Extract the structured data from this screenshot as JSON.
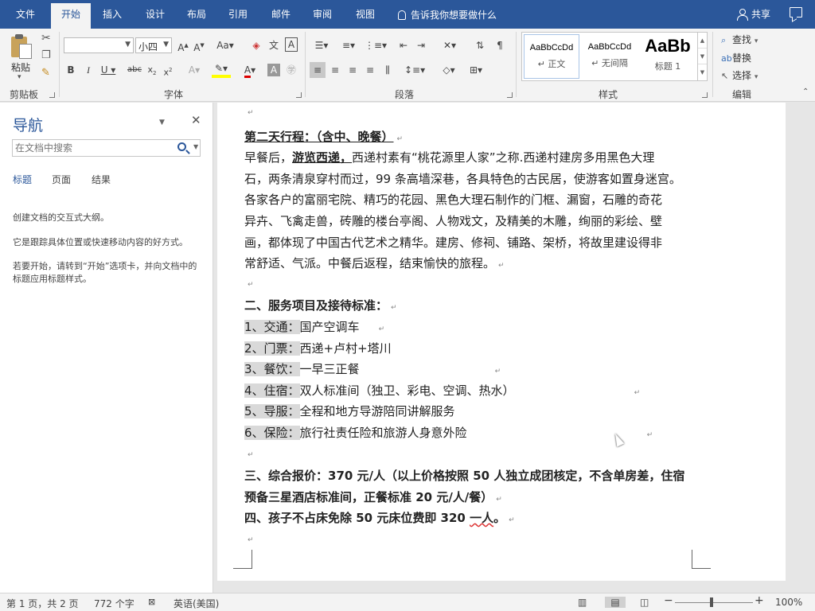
{
  "tabs": {
    "file": "文件",
    "home": "开始",
    "insert": "插入",
    "design": "设计",
    "layout": "布局",
    "references": "引用",
    "mailings": "邮件",
    "review": "审阅",
    "view": "视图",
    "tell_me": "告诉我你想要做什么",
    "share": "共享"
  },
  "ribbon": {
    "clipboard": {
      "paste": "粘贴",
      "label": "剪贴板"
    },
    "font": {
      "name": "",
      "size": "小四",
      "label": "字体"
    },
    "paragraph": {
      "label": "段落"
    },
    "styles": {
      "label": "样式",
      "items": [
        {
          "sample": "AaBbCcDd",
          "name": "↵ 正文"
        },
        {
          "sample": "AaBbCcDd",
          "name": "↵ 无间隔"
        },
        {
          "sample": "AaBb",
          "name": "标题 1"
        }
      ]
    },
    "editing": {
      "find": "查找",
      "replace": "替换",
      "select": "选择",
      "label": "编辑"
    }
  },
  "nav": {
    "title": "导航",
    "search_placeholder": "在文档中搜索",
    "tabs": [
      "标题",
      "页面",
      "结果"
    ],
    "msg1": "创建文档的交互式大纲。",
    "msg2": "它是跟踪具体位置或快速移动内容的好方式。",
    "msg3": "若要开始，请转到“开始”选项卡，并向文档中的标题应用标题样式。"
  },
  "doc": {
    "day2_heading": "第二天行程：（含中、晚餐）",
    "p1_a": "早餐后，",
    "p1_b": "游览西递，",
    "p1_c": "西递村素有“桃花源里人家”之称.西递村建房多用黑色大理",
    "p2": "石，两条清泉穿村而过，99 条高墙深巷，各具特色的古民居，使游客如置身迷宫。",
    "p3": "各家各户的富丽宅院、精巧的花园、黑色大理石制作的门框、漏窗，石雕的奇花",
    "p4": "异卉、飞禽走兽，砖雕的楼台亭阁、人物戏文，及精美的木雕，绚丽的彩绘、壁",
    "p5": "画，都体现了中国古代艺术之精华。建房、修祠、铺路、架桥，将故里建设得非",
    "p6": "常舒适、气派。中餐后返程，结束愉快的旅程。",
    "section2": "二、服务项目及接待标准：",
    "items": [
      {
        "label": "1、交通：",
        "value": "国产空调车"
      },
      {
        "label": "2、门票：",
        "value": "西递+卢村+塔川"
      },
      {
        "label": "3、餐饮：",
        "value": "一早三正餐"
      },
      {
        "label": "4、住宿：",
        "value": "双人标准间（独卫、彩电、空调、热水）"
      },
      {
        "label": "5、导服：",
        "value": "全程和地方导游陪同讲解服务"
      },
      {
        "label": "6、保险：",
        "value": "旅行社责任险和旅游人身意外险"
      }
    ],
    "section3_a": "三、综合报价：370 元/人（以上价格按照 50 人独立成团核定，不含单房差，住宿",
    "section3_b": "预备三星酒店标准间，正餐标准 20 元/人/餐）",
    "section4_a": "四、孩子不占床免除 50 元床位费即 320 ",
    "section4_b": "一人",
    "section4_c": "。"
  },
  "status": {
    "page": "第 1 页，共 2 页",
    "words": "772 个字",
    "lang": "英语(美国)",
    "zoom": "100%"
  }
}
